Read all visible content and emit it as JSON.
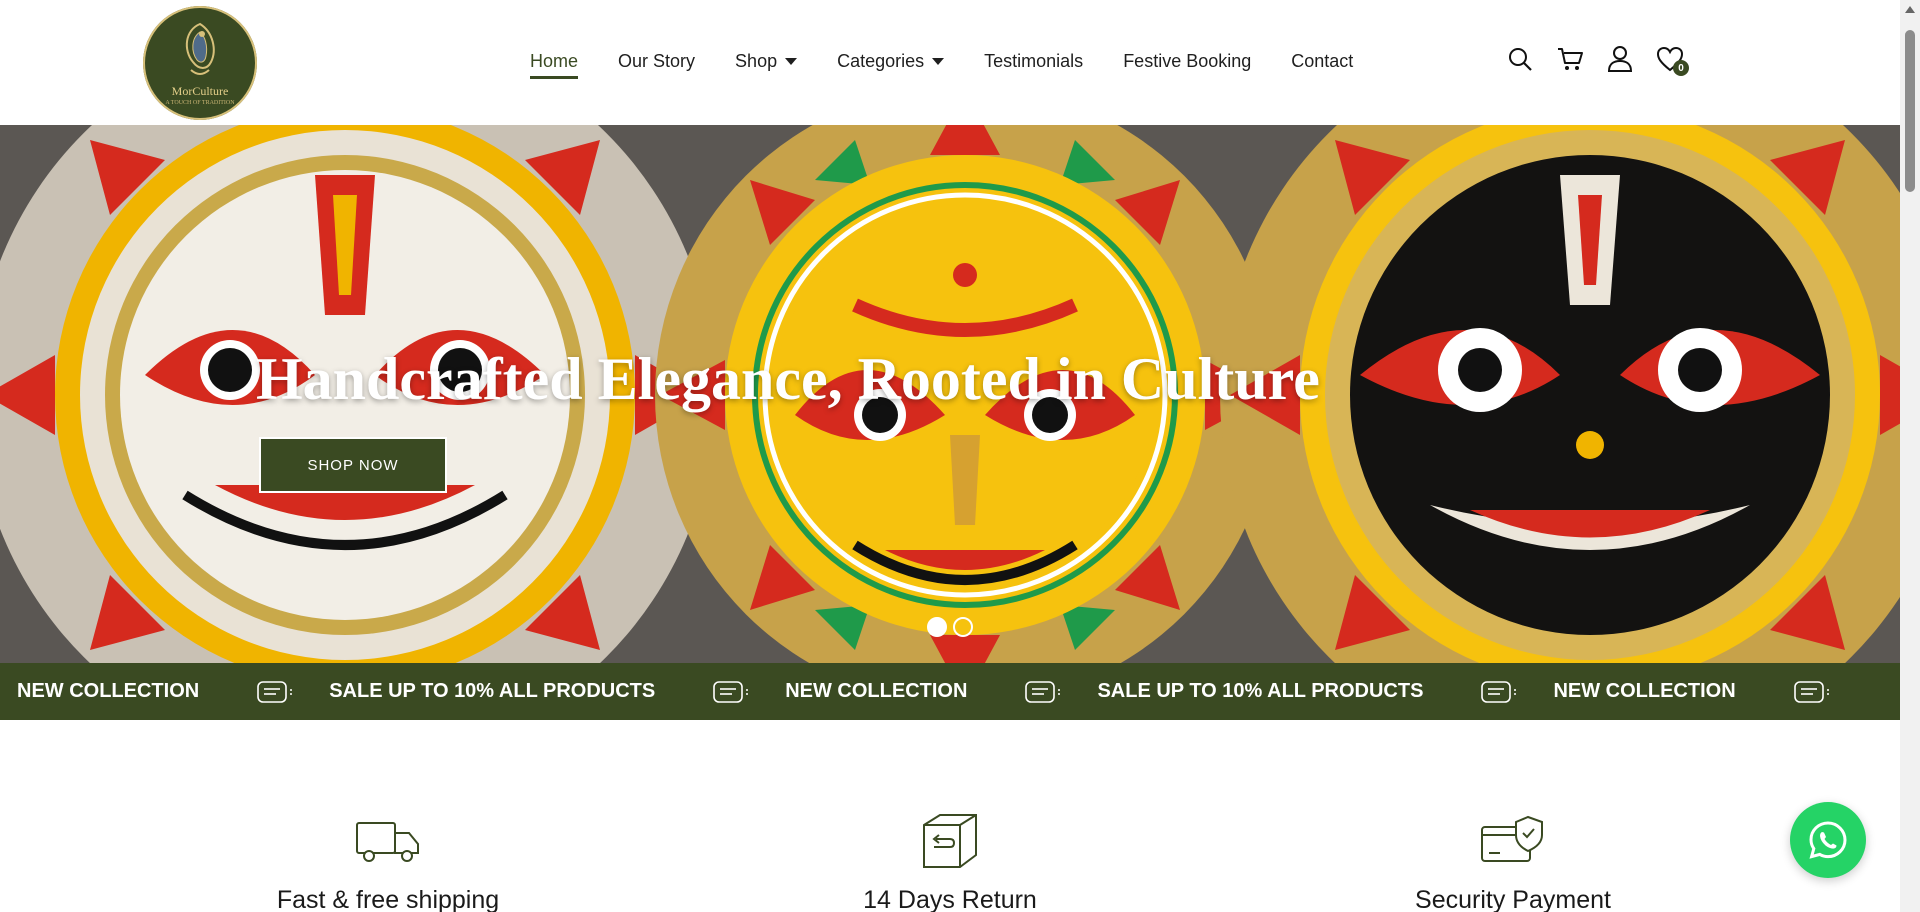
{
  "brand": {
    "logo_text": "MorCulture",
    "logo_sub": "A TOUCH OF TRADITION",
    "primary_color": "#3a4a22",
    "accent_color": "#d7c07a"
  },
  "nav": {
    "items": [
      {
        "label": "Home",
        "active": true,
        "dropdown": false
      },
      {
        "label": "Our Story",
        "active": false,
        "dropdown": false
      },
      {
        "label": "Shop",
        "active": false,
        "dropdown": true
      },
      {
        "label": "Categories",
        "active": false,
        "dropdown": true
      },
      {
        "label": "Testimonials",
        "active": false,
        "dropdown": false
      },
      {
        "label": "Festive Booking",
        "active": false,
        "dropdown": false
      },
      {
        "label": "Contact",
        "active": false,
        "dropdown": false
      }
    ]
  },
  "header_icons": {
    "search": "search-icon",
    "cart": "cart-icon",
    "account": "user-icon",
    "wishlist": "heart-icon",
    "wishlist_count": "0"
  },
  "hero": {
    "title": "Handcrafted Elegance, Rooted in Culture",
    "button_label": "SHOP NOW",
    "slides": 2,
    "active_slide": 1
  },
  "marquee": {
    "items": [
      "NEW COLLECTION",
      "SALE UP TO 10% ALL PRODUCTS",
      "NEW COLLECTION",
      "SALE UP TO 10% ALL PRODUCTS",
      "NEW COLLECTION"
    ],
    "icon": "receipt-icon"
  },
  "features": [
    {
      "title": "Fast & free shipping",
      "icon": "truck-icon"
    },
    {
      "title": "14 Days Return",
      "icon": "return-box-icon"
    },
    {
      "title": "Security Payment",
      "icon": "secure-card-icon"
    }
  ],
  "whatsapp": {
    "icon": "whatsapp-icon",
    "color": "#25d366"
  }
}
